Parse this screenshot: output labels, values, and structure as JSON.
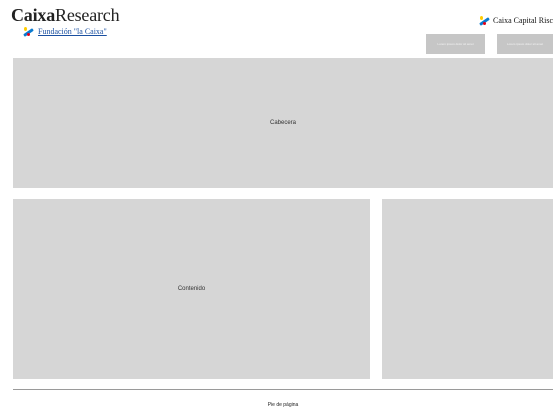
{
  "header": {
    "brand_bold": "Caixa",
    "brand_rest": "Research",
    "foundation_label": "Fundación \"la Caixa\"",
    "capital_label": "Caixa Capital Risc",
    "buttons": [
      {
        "label": "Lorem ipsum dolor sit amet"
      },
      {
        "label": "Lorem ipsum dolor sit amet"
      }
    ]
  },
  "layout": {
    "header_block_label": "Cabecera",
    "content_block_label": "Contenido",
    "sidebar_block_label": "",
    "footer_label": "Pie de página"
  },
  "colors": {
    "block_fill": "#d6d6d6",
    "button_fill": "#c6c6c6",
    "logo_blue": "#0a7bd0",
    "logo_yellow": "#ffcc00",
    "logo_red": "#e2001a"
  },
  "icons": {
    "foundation": "caixa-star-icon",
    "capital": "caixa-star-icon"
  }
}
